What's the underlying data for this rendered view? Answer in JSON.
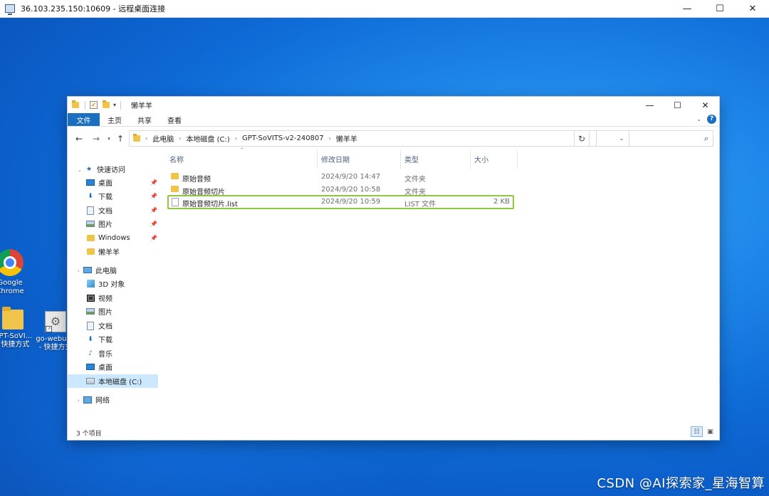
{
  "remote_window": {
    "title": "36.103.235.150:10609 - 远程桌面连接",
    "controls": {
      "minimize": "—",
      "maximize": "☐",
      "close": "✕"
    }
  },
  "desktop": {
    "icons": [
      {
        "label_line1": "Google",
        "label_line2": "Chrome"
      },
      {
        "label_line1": "GPT-SoVI...",
        "label_line2": "- 快捷方式"
      },
      {
        "label_line1": "go-webui...",
        "label_line2": "- 快捷方式"
      }
    ],
    "watermark": "CSDN @AI探索家_星海智算"
  },
  "explorer": {
    "title": "懒羊羊",
    "qa_arrow": "▾",
    "controls": {
      "minimize": "—",
      "maximize": "☐",
      "close": "✕"
    },
    "ribbon": {
      "file_tab": "文件",
      "tabs": [
        "主页",
        "共享",
        "查看"
      ],
      "collapse": "⌄",
      "help": "?"
    },
    "address": {
      "back": "←",
      "forward": "→",
      "recent": "▾",
      "up": "↑",
      "crumbs": [
        "此电脑",
        "本地磁盘 (C:)",
        "GPT-SoVITS-v2-240807",
        "懒羊羊"
      ],
      "crumb_sep": "›",
      "dropdown": "⌄",
      "refresh": "↻",
      "search_placeholder": "",
      "search_icon": "⌕"
    },
    "nav_pane": {
      "quick_access": "快速访问",
      "quick_items": [
        {
          "label": "桌面",
          "icon": "desktop-icon",
          "pinned": true
        },
        {
          "label": "下载",
          "icon": "download-icon",
          "pinned": true
        },
        {
          "label": "文档",
          "icon": "document-icon",
          "pinned": true
        },
        {
          "label": "图片",
          "icon": "picture-icon",
          "pinned": true
        },
        {
          "label": "Windows",
          "icon": "folder-icon",
          "pinned": true
        },
        {
          "label": "懒羊羊",
          "icon": "folder-icon",
          "pinned": false
        }
      ],
      "this_pc": "此电脑",
      "pc_items": [
        {
          "label": "3D 对象",
          "icon": "3d-objects-icon"
        },
        {
          "label": "视频",
          "icon": "video-icon"
        },
        {
          "label": "图片",
          "icon": "picture-icon"
        },
        {
          "label": "文档",
          "icon": "document-icon"
        },
        {
          "label": "下载",
          "icon": "download-icon"
        },
        {
          "label": "音乐",
          "icon": "music-icon"
        },
        {
          "label": "桌面",
          "icon": "desktop-icon"
        },
        {
          "label": "本地磁盘 (C:)",
          "icon": "drive-icon",
          "selected": true
        }
      ],
      "network": "网络",
      "pin_glyph": "📌"
    },
    "columns": {
      "name": "名称",
      "modified": "修改日期",
      "type": "类型",
      "size": "大小",
      "sort_glyph": "^"
    },
    "files": [
      {
        "name": "原始音频",
        "modified": "2024/9/20 14:47",
        "type": "文件夹",
        "size": "",
        "kind": "folder"
      },
      {
        "name": "原始音频切片",
        "modified": "2024/9/20 10:58",
        "type": "文件夹",
        "size": "",
        "kind": "folder"
      },
      {
        "name": "原始音频切片.list",
        "modified": "2024/9/20 10:59",
        "type": "LIST 文件",
        "size": "2 KB",
        "kind": "file",
        "highlighted": true
      }
    ],
    "status": "3 个项目"
  }
}
